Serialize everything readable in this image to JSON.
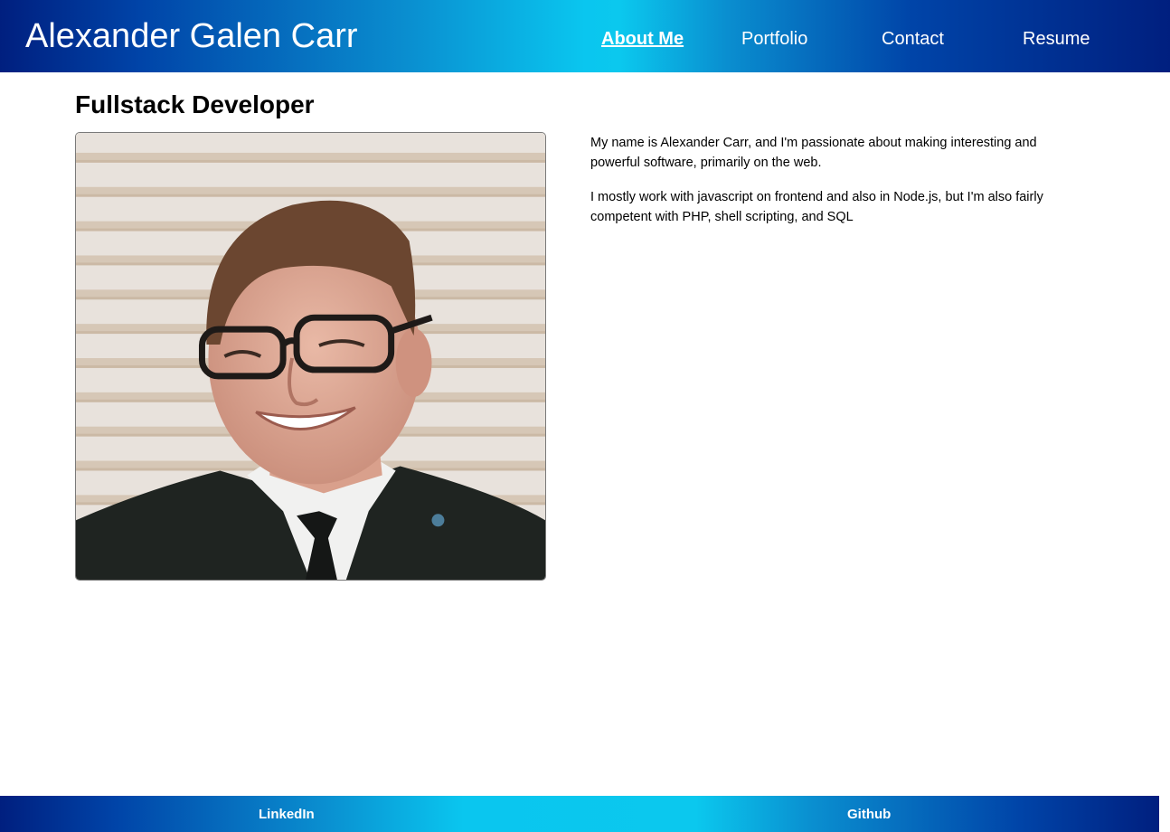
{
  "header": {
    "site_title": "Alexander Galen Carr",
    "nav": {
      "about": "About Me",
      "portfolio": "Portfolio",
      "contact": "Contact",
      "resume": "Resume"
    },
    "active_nav": "about"
  },
  "main": {
    "heading": "Fullstack Developer",
    "photo": {
      "description_icon": "profile-photo"
    },
    "bio": [
      "My name is Alexander Carr, and I'm passionate about making interesting and powerful software, primarily on the web.",
      "I mostly work with javascript on frontend and also in Node.js, but I'm also fairly competent with PHP, shell scripting, and SQL"
    ]
  },
  "footer": {
    "linkedin": "LinkedIn",
    "github": "Github"
  },
  "colors": {
    "gradient_dark": "#001f7f",
    "gradient_light": "#0ac6ef",
    "text_light": "#ffffff"
  }
}
